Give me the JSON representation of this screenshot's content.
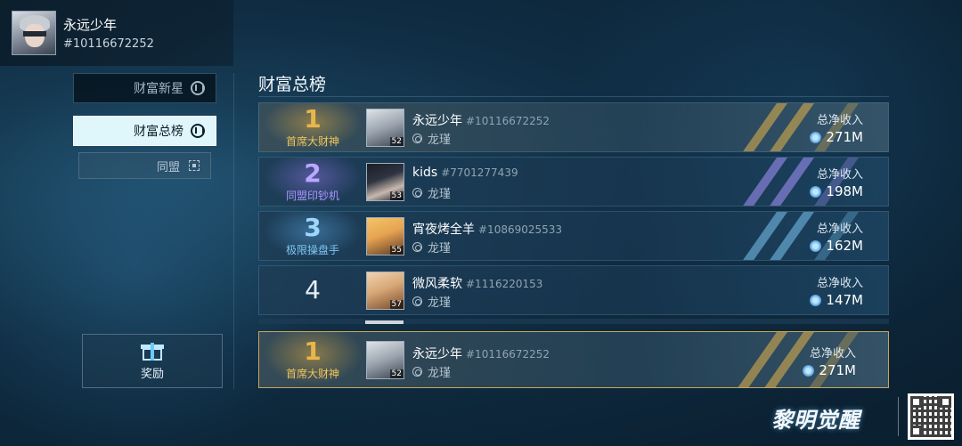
{
  "profile": {
    "name": "永远少年",
    "id": "#10116672252"
  },
  "nav": {
    "new_star": "财富新星",
    "total": "财富总榜",
    "alliance": "同盟",
    "reward": "奖励"
  },
  "board": {
    "title": "财富总榜",
    "rows": [
      {
        "rank": "1",
        "rank_title": "首席大财神",
        "name": "永远少年",
        "id": "#10116672252",
        "level": "52",
        "guild": "龙瑾",
        "income_label": "总净收入",
        "income": "271M"
      },
      {
        "rank": "2",
        "rank_title": "同盟印钞机",
        "name": "kids",
        "id": "#7701277439",
        "level": "53",
        "guild": "龙瑾",
        "income_label": "总净收入",
        "income": "198M"
      },
      {
        "rank": "3",
        "rank_title": "极限操盘手",
        "name": "宵夜烤全羊",
        "id": "#10869025533",
        "level": "55",
        "guild": "龙瑾",
        "income_label": "总净收入",
        "income": "162M"
      },
      {
        "rank": "4",
        "rank_title": "",
        "name": "微风柔软",
        "id": "#1116220153",
        "level": "57",
        "guild": "龙瑾",
        "income_label": "总净收入",
        "income": "147M"
      }
    ],
    "mine": {
      "rank": "1",
      "rank_title": "首席大财神",
      "name": "永远少年",
      "id": "#10116672252",
      "level": "52",
      "guild": "龙瑾",
      "income_label": "总净收入",
      "income": "271M"
    }
  },
  "brand": {
    "logo_text": "黎明觉醒"
  },
  "colors": {
    "gold": "#e8b64a",
    "purple": "#a995ff",
    "blue": "#7cc6f2",
    "accent_nav": "#dff6fb"
  },
  "icons": {
    "nav": "hand-icon",
    "alliance": "target-icon",
    "reward": "gift-icon",
    "currency": "coin-icon",
    "guild": "guild-icon"
  }
}
